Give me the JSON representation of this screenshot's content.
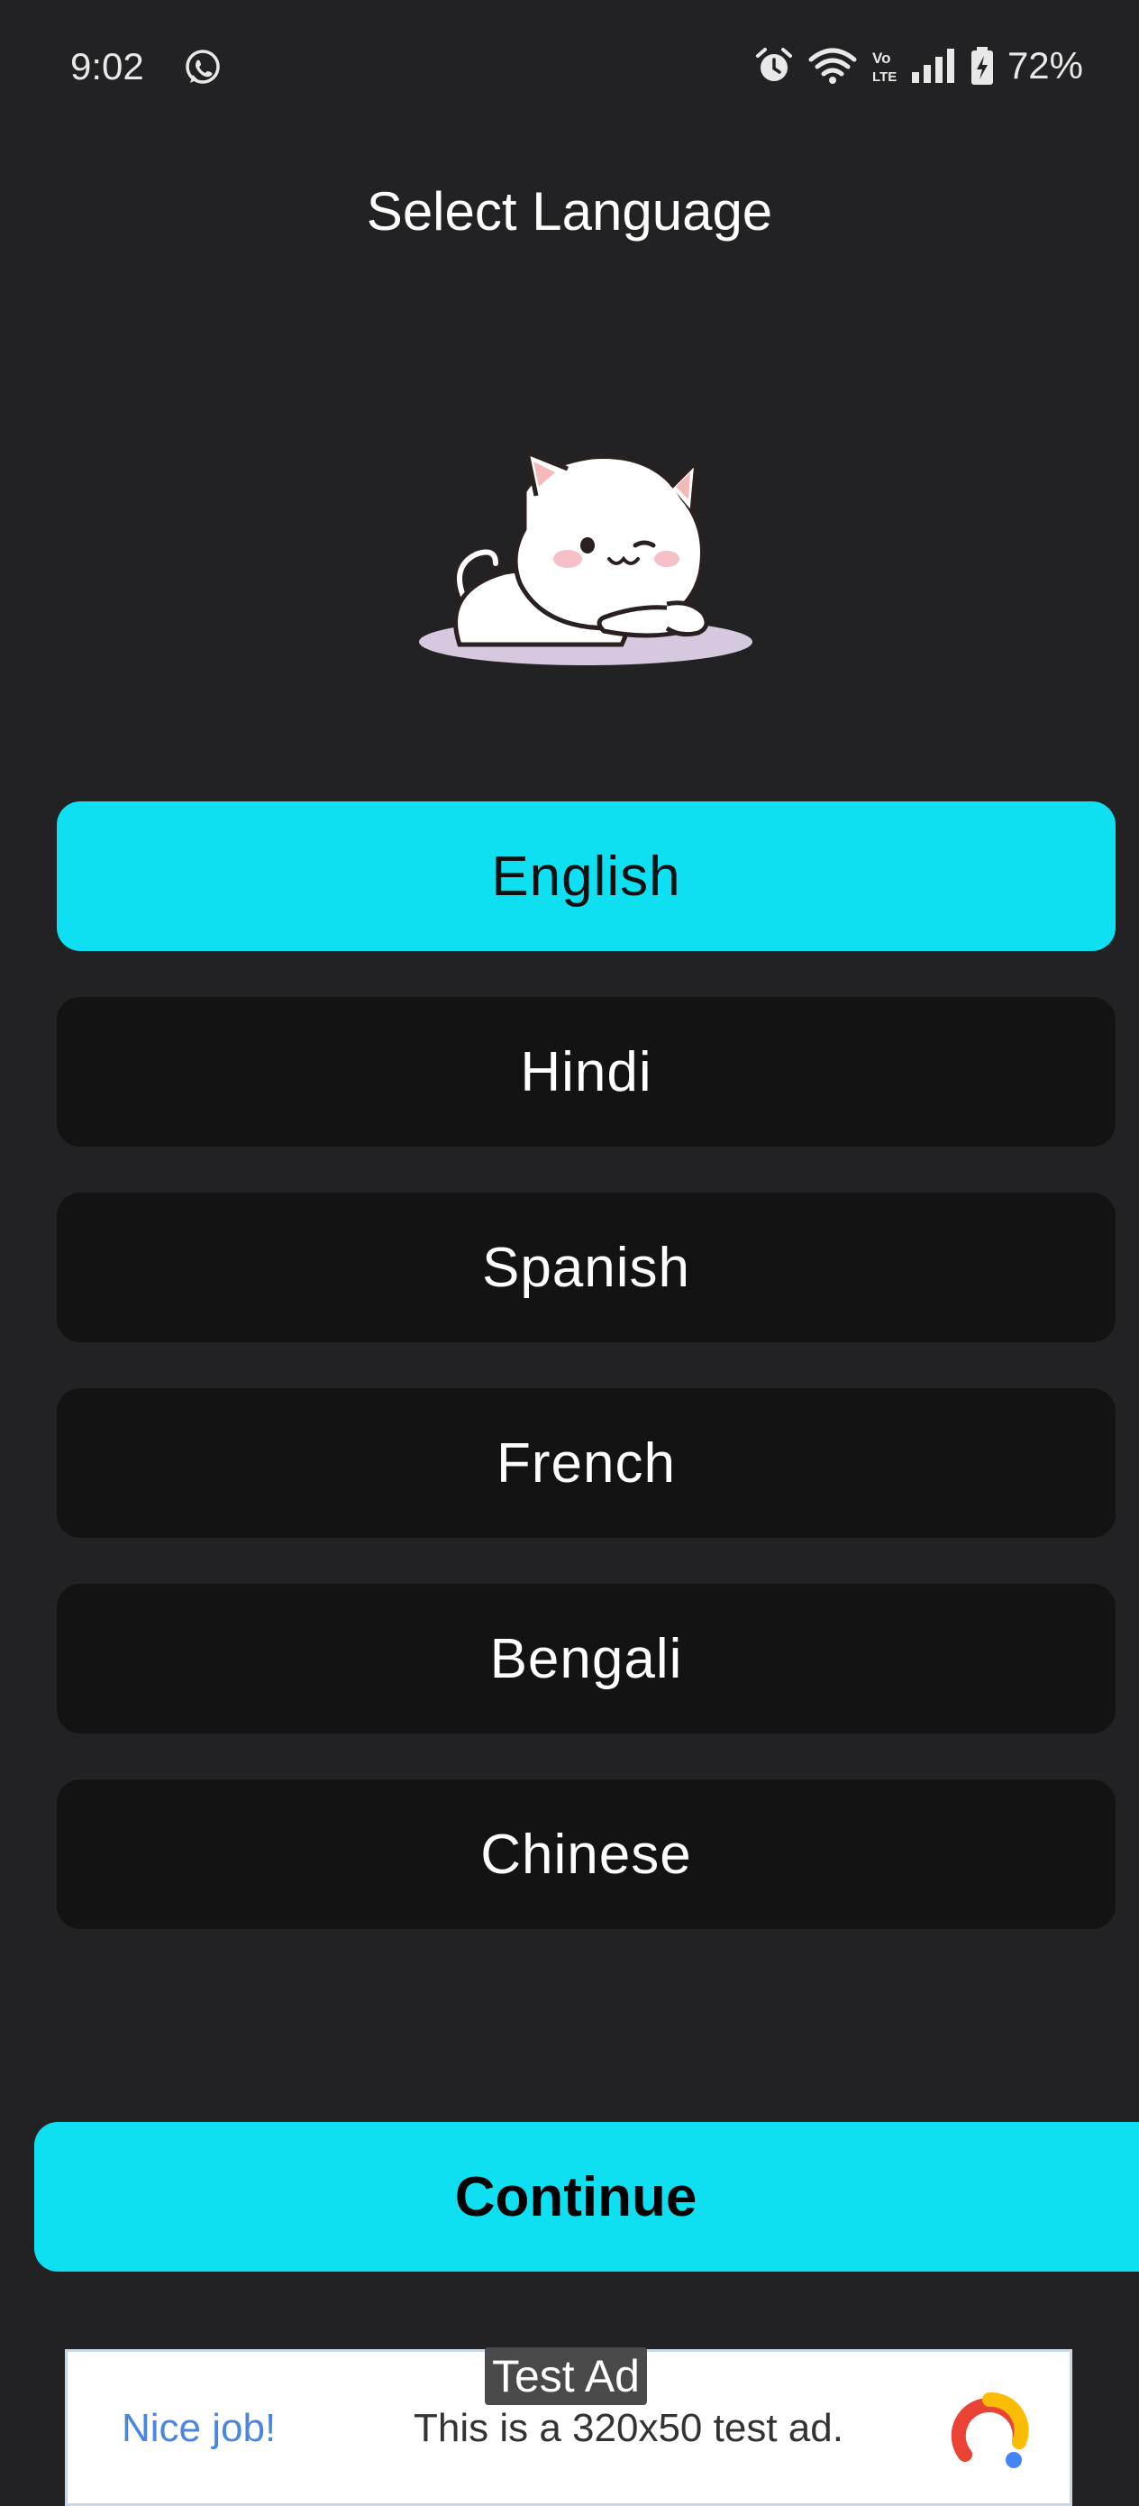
{
  "status_bar": {
    "time": "9:02",
    "left_icon": "whatsapp-icon",
    "right_icons": [
      "alarm-icon",
      "wifi-icon",
      "volte-icon",
      "signal-icon",
      "battery-charging-icon"
    ],
    "battery_percent": "72%"
  },
  "header": {
    "title": "Select Language"
  },
  "mascot": {
    "icon": "cat-mascot-image"
  },
  "languages": {
    "selected": "English",
    "items": [
      {
        "label": "English",
        "selected": true
      },
      {
        "label": "Hindi",
        "selected": false
      },
      {
        "label": "Spanish",
        "selected": false
      },
      {
        "label": "French",
        "selected": false
      },
      {
        "label": "Bengali",
        "selected": false
      },
      {
        "label": "Chinese",
        "selected": false
      }
    ]
  },
  "actions": {
    "continue_label": "Continue"
  },
  "ad": {
    "tag": "Test Ad",
    "headline": "Nice job!",
    "body": "This is a 320x50 test ad.",
    "logo": "ad-network-logo"
  },
  "colors": {
    "background": "#222224",
    "accent": "#0ee0f2",
    "button_bg": "#131314"
  }
}
